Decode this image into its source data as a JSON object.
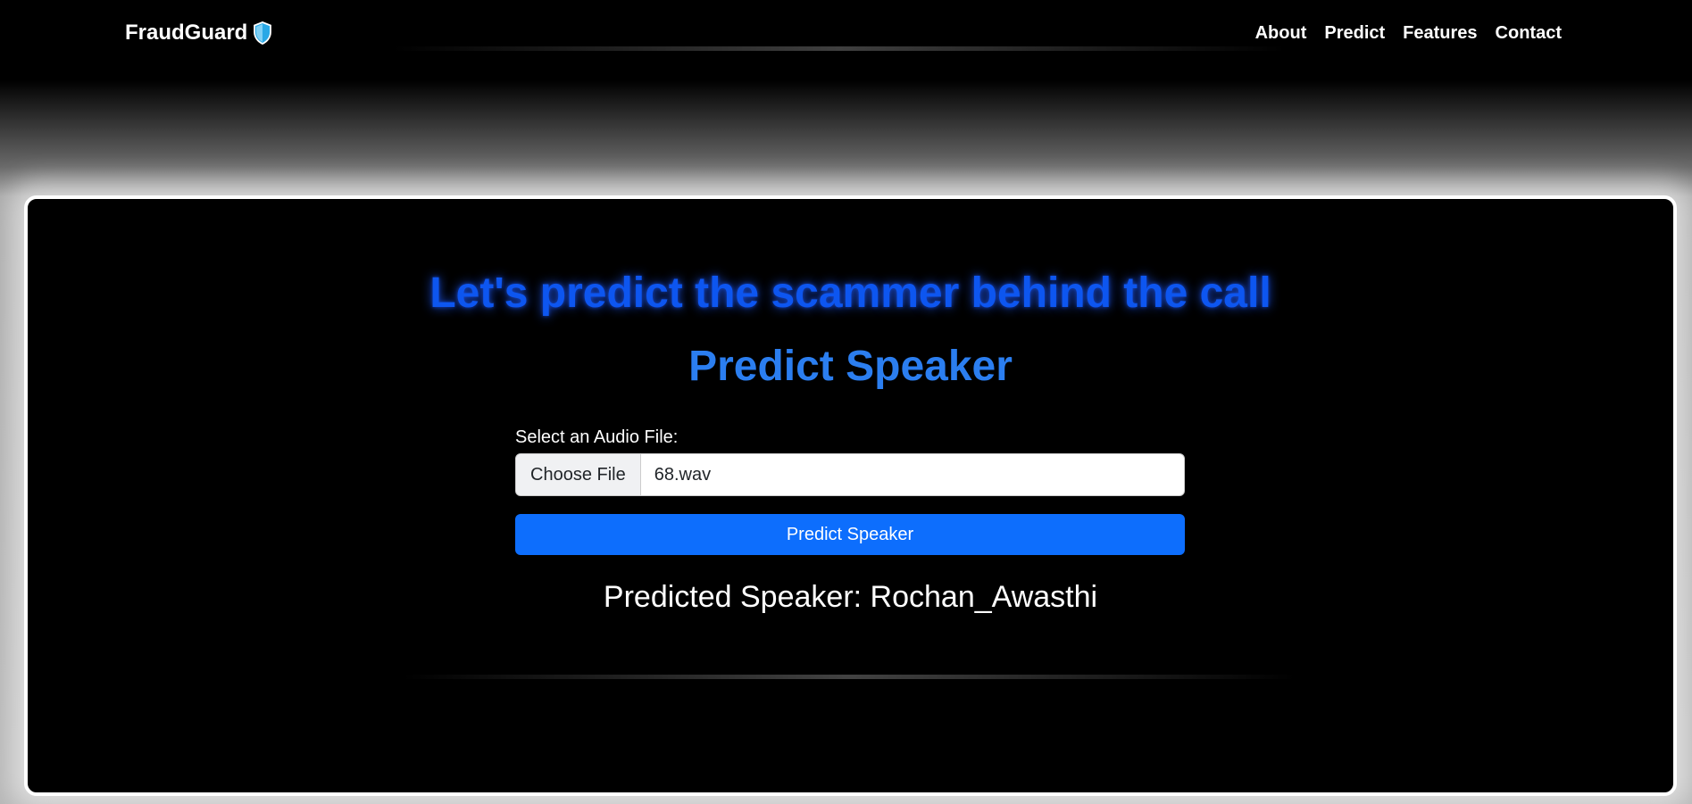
{
  "navbar": {
    "brand": "FraudGuard",
    "brand_icon": "shield-icon",
    "links": [
      "About",
      "Predict",
      "Features",
      "Contact"
    ]
  },
  "main": {
    "headline": "Let's predict the scammer behind the call",
    "subhead": "Predict Speaker",
    "file_label": "Select an Audio File:",
    "file_button": "Choose File",
    "file_name": "68.wav",
    "submit_label": "Predict Speaker",
    "result": "Predicted Speaker: Rochan_Awasthi"
  },
  "colors": {
    "headline": "#0d56f0",
    "subhead": "#2b7ef0",
    "button": "#0d6efd",
    "shield": "#29a8e6"
  }
}
